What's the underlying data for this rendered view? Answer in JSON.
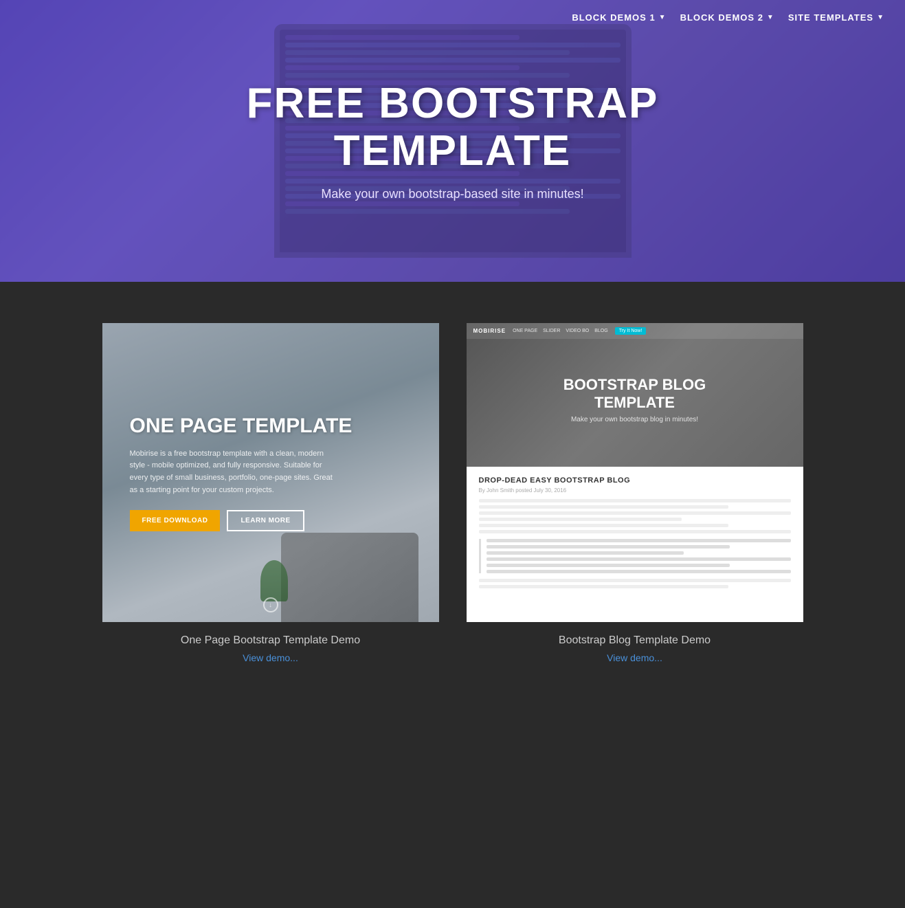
{
  "nav": {
    "items": [
      {
        "id": "block-demos-1",
        "label": "BLOCK DEMOS 1",
        "hasDropdown": true
      },
      {
        "id": "block-demos-2",
        "label": "BLOCK DEMOS 2",
        "hasDropdown": true
      },
      {
        "id": "site-templates",
        "label": "SITE TEMPLATES",
        "hasDropdown": true
      }
    ]
  },
  "hero": {
    "title": "FREE BOOTSTRAP\nTEMPLATE",
    "subtitle": "Make your own bootstrap-based site in minutes!"
  },
  "cards": [
    {
      "id": "one-page",
      "template_label": "ONE PAGE TEMPLATE",
      "description": "Mobirise is a free bootstrap template with a clean, modern style - mobile optimized, and fully responsive. Suitable for every type of small business, portfolio, one-page sites. Great as a starting point for your custom projects.",
      "btn_primary": "FREE DOWNLOAD",
      "btn_secondary": "LEARN MORE",
      "footer_title": "One Page Bootstrap Template Demo",
      "footer_link": "View demo..."
    },
    {
      "id": "bootstrap-blog",
      "mini_brand": "MOBIRISE",
      "mini_links": [
        "ONE PAGE",
        "SLIDER",
        "VIDEO BO",
        "BLOG"
      ],
      "mini_cta": "Try It Now!",
      "blog_header_title": "BOOTSTRAP BLOG\nTEMPLATE",
      "blog_header_subtitle": "Make your own bootstrap blog in minutes!",
      "blog_post_title": "DROP-DEAD EASY BOOTSTRAP BLOG",
      "blog_post_meta": "By John Smith posted July 30, 2016",
      "footer_title": "Bootstrap Blog Template Demo",
      "footer_link": "View demo..."
    }
  ]
}
